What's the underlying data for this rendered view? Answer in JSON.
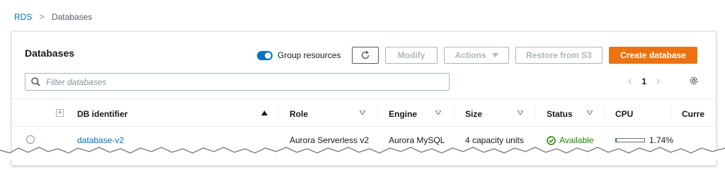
{
  "breadcrumb": {
    "root": "RDS",
    "separator": ">",
    "current": "Databases"
  },
  "panel": {
    "title": "Databases"
  },
  "toolbar": {
    "group_label": "Group resources",
    "group_on": true,
    "modify_label": "Modify",
    "actions_label": "Actions",
    "restore_label": "Restore from S3",
    "create_label": "Create database"
  },
  "search": {
    "placeholder": "Filter databases",
    "value": ""
  },
  "pagination": {
    "page": "1"
  },
  "table": {
    "columns": [
      "DB identifier",
      "Role",
      "Engine",
      "Size",
      "Status",
      "CPU",
      "Curre"
    ],
    "rows": [
      {
        "db_identifier": "database-v2",
        "role": "Aurora Serverless v2",
        "engine": "Aurora MySQL",
        "size": "4 capacity units",
        "status": "Available",
        "cpu": "1.74%",
        "cpu_fraction": 0.0174
      }
    ]
  },
  "colors": {
    "accent": "#0073bb",
    "primary": "#ec7211",
    "success": "#1d8102"
  }
}
